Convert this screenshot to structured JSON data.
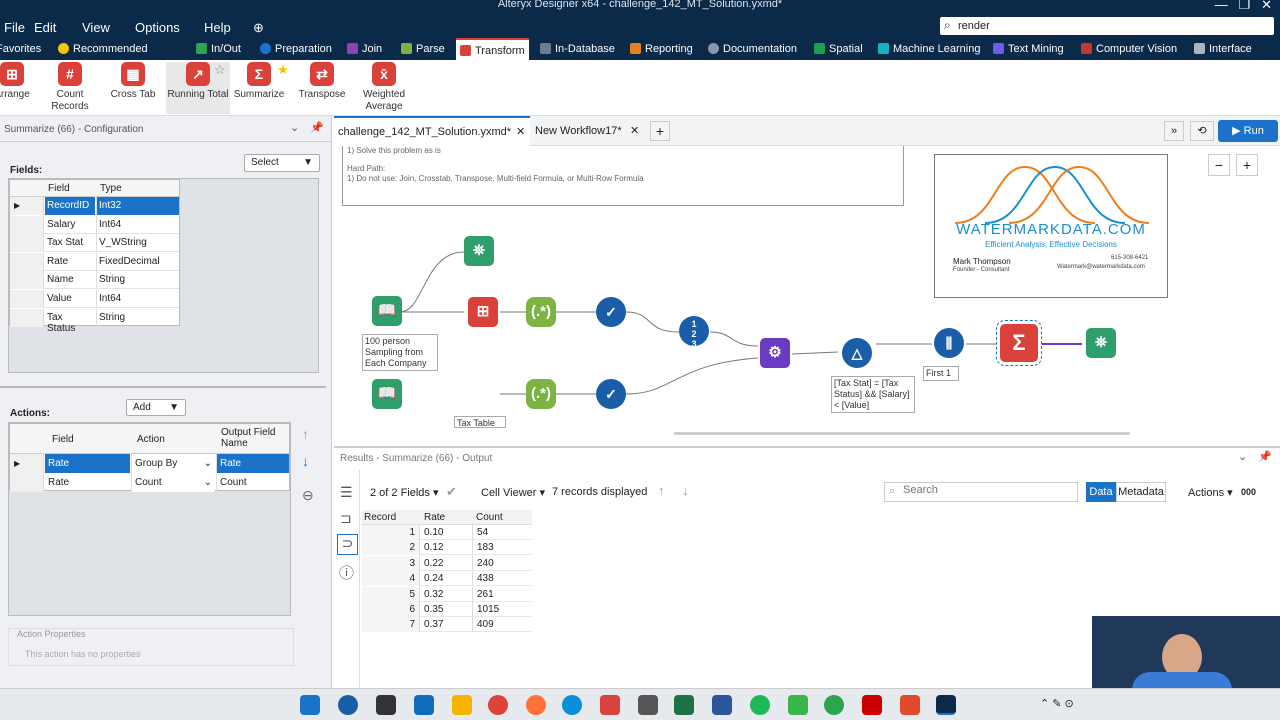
{
  "window": {
    "title": "Alteryx Designer x64 - challenge_142_MT_Solution.yxmd*",
    "search_value": "render"
  },
  "menu": [
    "File",
    "Edit",
    "View",
    "Options",
    "Help"
  ],
  "categories": [
    "Favorites",
    "Recommended",
    "In/Out",
    "Preparation",
    "Join",
    "Parse",
    "Transform",
    "In-Database",
    "Reporting",
    "Documentation",
    "Spatial",
    "Machine Learning",
    "Text Mining",
    "Computer Vision",
    "Interface"
  ],
  "tools": [
    {
      "label": "Arrange",
      "color": "#d9413a"
    },
    {
      "label": "Count Records",
      "color": "#d9413a"
    },
    {
      "label": "Cross Tab",
      "color": "#d9413a"
    },
    {
      "label": "Running Total",
      "color": "#d9413a"
    },
    {
      "label": "Summarize",
      "color": "#d9413a"
    },
    {
      "label": "Transpose",
      "color": "#d9413a"
    },
    {
      "label": "Weighted Average",
      "color": "#d9413a"
    }
  ],
  "config": {
    "title": "Summarize (66) - Configuration",
    "fields_label": "Fields:",
    "select_label": "Select",
    "field_headers": [
      "Field",
      "Type"
    ],
    "fields": [
      [
        "RecordID",
        "Int32"
      ],
      [
        "Salary",
        "Int64"
      ],
      [
        "Tax Stat",
        "V_WString"
      ],
      [
        "Rate",
        "FixedDecimal"
      ],
      [
        "Name",
        "String"
      ],
      [
        "Value",
        "Int64"
      ],
      [
        "Tax Status",
        "String"
      ]
    ],
    "actions_label": "Actions:",
    "add_label": "Add",
    "action_headers": [
      "Field",
      "Action",
      "Output Field Name"
    ],
    "actions": [
      [
        "Rate",
        "Group By",
        "Rate"
      ],
      [
        "Rate",
        "Count",
        "Count"
      ]
    ],
    "props_title": "Action Properties",
    "props_text": "This action has no properties"
  },
  "tabs": {
    "active": "challenge_142_MT_Solution.yxmd*",
    "other": "New Workflow17*",
    "run": "Run"
  },
  "canvas": {
    "note_line1": "1) Solve this problem as is",
    "note_line2": "Hard Path:",
    "note_line3": "1) Do not use: Join, Crosstab, Transpose, Multi-field Formula, or Multi-Row Formula",
    "anno_input": "100 person Sampling from Each Company",
    "anno_tax": "Tax Table",
    "anno_filter": "[Tax Stat] = [Tax Status] && [Salary] < [Value]",
    "anno_first": "First 1",
    "logo_brand": "WATERMARKDATA.COM",
    "logo_tag": "Efficient Analysis, Effective Decisions",
    "logo_name": "Mark Thompson",
    "logo_role": "Founder - Consultant",
    "logo_phone": "615-308-6421",
    "logo_email": "Watermark@watermarkdata.com"
  },
  "results": {
    "title": "Results - Summarize (66) - Output",
    "fields_info": "2 of 2 Fields",
    "cell_viewer": "Cell Viewer",
    "records_info": "7 records displayed",
    "search_placeholder": "Search",
    "data_tab": "Data",
    "meta_tab": "Metadata",
    "actions": "Actions",
    "headers": [
      "Record",
      "Rate",
      "Count"
    ],
    "rows": [
      [
        "1",
        "0.10",
        "54"
      ],
      [
        "2",
        "0.12",
        "183"
      ],
      [
        "3",
        "0.22",
        "240"
      ],
      [
        "4",
        "0.24",
        "438"
      ],
      [
        "5",
        "0.32",
        "261"
      ],
      [
        "6",
        "0.35",
        "1015"
      ],
      [
        "7",
        "0.37",
        "409"
      ]
    ]
  }
}
